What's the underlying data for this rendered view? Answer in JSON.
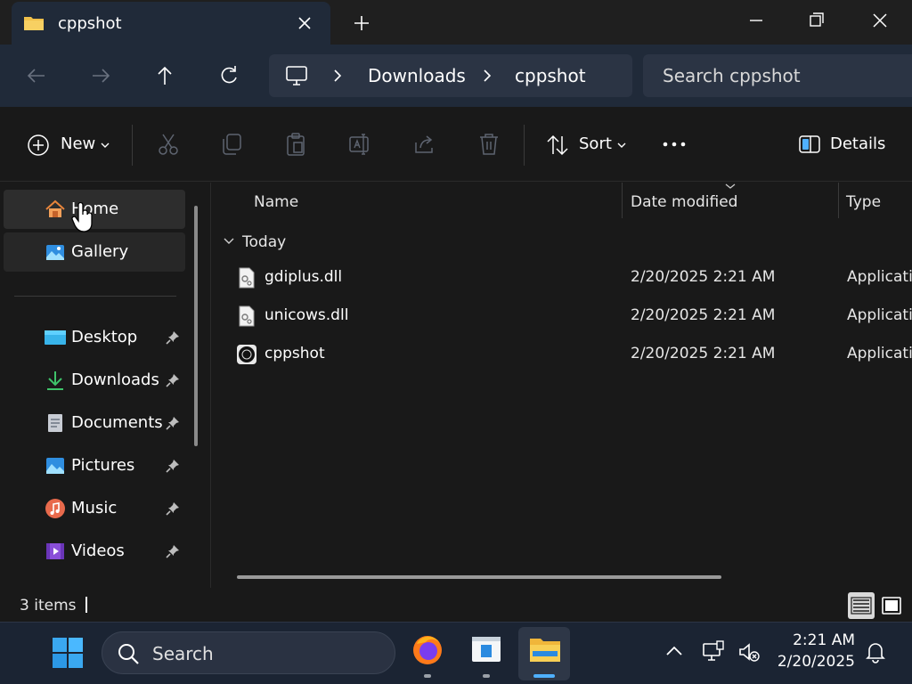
{
  "window": {
    "tab_title": "cppshot",
    "colors": {
      "titlebar": "#1f1f1f",
      "tab": "#202a39",
      "accent": "#4fb0ff"
    }
  },
  "address": {
    "breadcrumb": [
      "Downloads",
      "cppshot"
    ],
    "search_placeholder": "Search cppshot"
  },
  "commandbar": {
    "new_label": "New",
    "sort_label": "Sort",
    "details_label": "Details",
    "icons": [
      "cut-icon",
      "copy-icon",
      "paste-icon",
      "rename-icon",
      "share-icon",
      "delete-icon"
    ]
  },
  "sidebar": {
    "items": [
      {
        "label": "Home",
        "icon": "home-icon"
      },
      {
        "label": "Gallery",
        "icon": "gallery-icon"
      },
      {
        "label": "Desktop",
        "icon": "desktop-icon",
        "pinned": true
      },
      {
        "label": "Downloads",
        "icon": "download-icon",
        "pinned": true
      },
      {
        "label": "Documents",
        "icon": "documents-icon",
        "pinned": true
      },
      {
        "label": "Pictures",
        "icon": "pictures-icon",
        "pinned": true
      },
      {
        "label": "Music",
        "icon": "music-icon",
        "pinned": true
      },
      {
        "label": "Videos",
        "icon": "videos-icon",
        "pinned": true
      }
    ]
  },
  "filelist": {
    "columns": [
      "Name",
      "Date modified",
      "Type"
    ],
    "group": "Today",
    "rows": [
      {
        "name": "gdiplus.dll",
        "date": "2/20/2025 2:21 AM",
        "type": "Applicatio",
        "icon": "dll-file-icon"
      },
      {
        "name": "unicows.dll",
        "date": "2/20/2025 2:21 AM",
        "type": "Applicatio",
        "icon": "dll-file-icon"
      },
      {
        "name": "cppshot",
        "date": "2/20/2025 2:21 AM",
        "type": "Applicatio",
        "icon": "cppshot-app-icon"
      }
    ]
  },
  "status": {
    "item_count": "3 items"
  },
  "taskbar": {
    "search_label": "Search",
    "time": "2:21 AM",
    "date": "2/20/2025"
  }
}
